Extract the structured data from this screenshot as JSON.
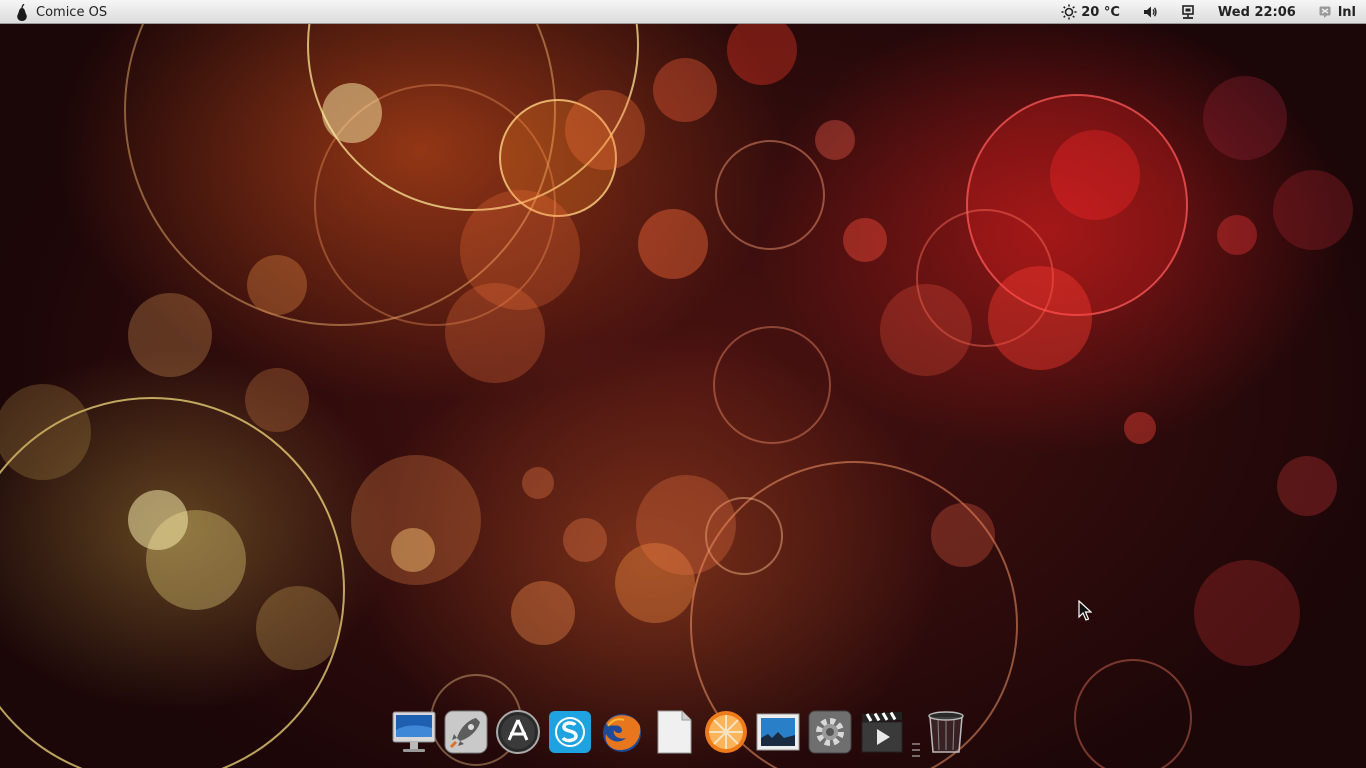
{
  "top_panel": {
    "app_name": "Comice OS",
    "weather": {
      "icon": "sun-icon",
      "temperature": "20 °C"
    },
    "volume_icon": "speaker-icon",
    "network_icon": "network-icon",
    "clock": "Wed 22:06",
    "user": {
      "icon": "user-switch-icon",
      "name": "lnl"
    }
  },
  "dock": {
    "items": [
      {
        "name": "computer",
        "icon": "imac-icon"
      },
      {
        "name": "launchpad",
        "icon": "rocket-icon"
      },
      {
        "name": "app-store",
        "icon": "app-store-icon"
      },
      {
        "name": "skype",
        "icon": "skype-icon"
      },
      {
        "name": "firefox",
        "icon": "firefox-icon"
      },
      {
        "name": "text-editor",
        "icon": "document-icon"
      },
      {
        "name": "orange-app",
        "icon": "orange-slice-icon"
      },
      {
        "name": "image-viewer",
        "icon": "photo-icon"
      },
      {
        "name": "system-settings",
        "icon": "gear-icon"
      },
      {
        "name": "video-player",
        "icon": "clapperboard-icon"
      },
      {
        "name": "trash",
        "icon": "trash-icon"
      }
    ]
  },
  "colors": {
    "panel_top": "#f6f6f6",
    "panel_bottom": "#dcdcdc",
    "wallpaper_dark": "#1b0608",
    "bokeh_red": "#e02020",
    "bokeh_orange": "#e86a2a"
  }
}
